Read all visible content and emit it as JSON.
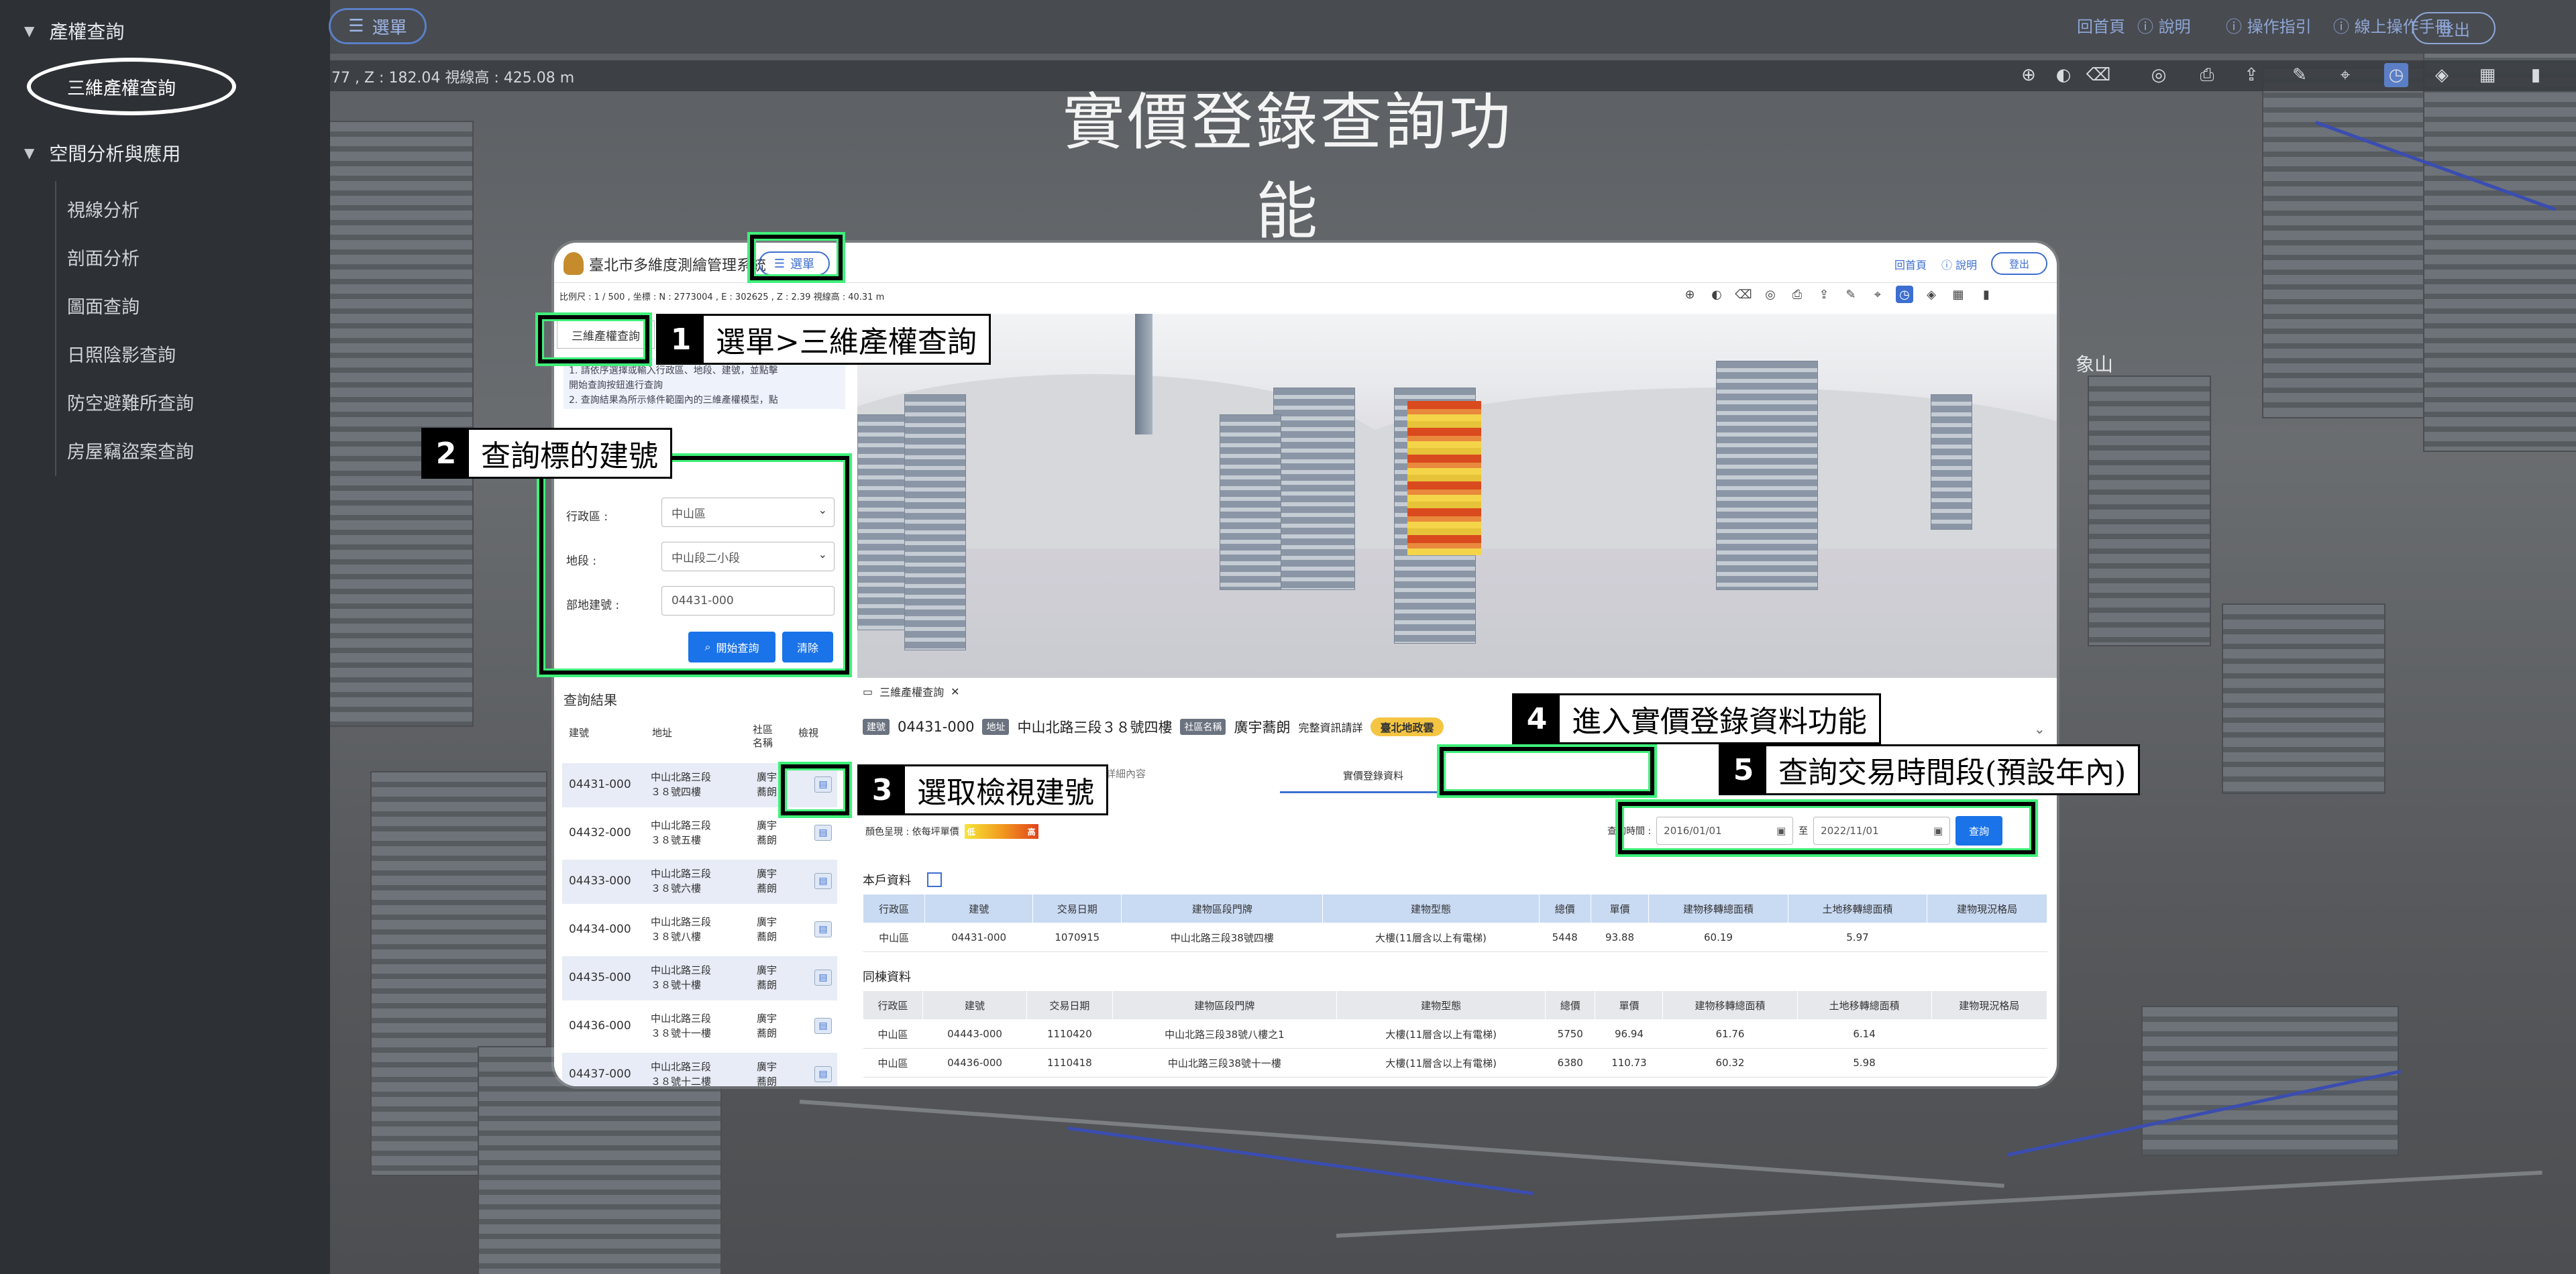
{
  "sidebar": {
    "groups": [
      {
        "label": "產權查詢",
        "items": [
          "三維產權查詢"
        ]
      },
      {
        "label": "空間分析與應用",
        "items": [
          "視線分析",
          "剖面分析",
          "圖面查詢",
          "日照陰影查詢",
          "防空避難所查詢",
          "房屋竊盜案查詢"
        ]
      }
    ],
    "active_item": "三維產權查詢"
  },
  "topbar": {
    "menu_label": "選單",
    "links": [
      "回首頁",
      "說明",
      "操作指引",
      "線上操作手冊"
    ],
    "logout_label": "登出"
  },
  "coords_text": "77 , Z : 182.04 視線高 : 425.08 m",
  "map_landmark": "象山",
  "main_title": "實價登錄查詢功能",
  "panel": {
    "app_title": "臺北市多維度測繪管理系統",
    "menu_label": "選單",
    "links": [
      "回首頁",
      "說明"
    ],
    "logout_label": "登出",
    "coords_text": "比例尺 : 1 / 500 , 坐標 : N : 2773004 , E : 302625 , Z : 2.39 視線高 : 40.31 m",
    "query_tab": "三維產權查詢",
    "notes": [
      "1. 請依序選擇或輸入行政區、地段、建號，並點擊",
      "開始查詢按鈕進行查詢",
      "2. 查詢結果為所示條件範圍內的三維產權模型，點"
    ],
    "form": {
      "district_label": "行政區 :",
      "district_value": "中山區",
      "section_label": "地段 :",
      "section_value": "中山段二小段",
      "building_label": "部地建號 :",
      "building_value": "04431-000",
      "search_btn": "開始查詢",
      "clear_btn": "清除"
    },
    "results": {
      "title": "查詢結果",
      "headers": [
        "建號",
        "地址",
        "社區名稱",
        "檢視"
      ],
      "rows": [
        {
          "no": "04431-000",
          "addr": "中山北路三段３８號四樓",
          "name": "廣宇蕎朗"
        },
        {
          "no": "04432-000",
          "addr": "中山北路三段３８號五樓",
          "name": "廣宇蕎朗"
        },
        {
          "no": "04433-000",
          "addr": "中山北路三段３８號六樓",
          "name": "廣宇蕎朗"
        },
        {
          "no": "04434-000",
          "addr": "中山北路三段３８號八樓",
          "name": "廣宇蕎朗"
        },
        {
          "no": "04435-000",
          "addr": "中山北路三段３８號十樓",
          "name": "廣宇蕎朗"
        },
        {
          "no": "04436-000",
          "addr": "中山北路三段３８號十一樓",
          "name": "廣宇蕎朗"
        },
        {
          "no": "04437-000",
          "addr": "中山北路三段３８號十二樓",
          "name": "廣宇蕎朗"
        }
      ]
    },
    "data": {
      "tab_label": "三維產權查詢",
      "tag_no": "建號",
      "building_no": "04431-000",
      "tag_addr": "地址",
      "address": "中山北路三段３８號四樓",
      "tag_comm": "社區名稱",
      "community": "廣宇蕎朗",
      "detail_link": "完整資訊請詳",
      "badge": "臺北地政雲",
      "sub_tab1": "詳細內容",
      "sub_tab2": "實價登錄資料",
      "legend_label": "顏色呈現 : 依每坪單價",
      "legend_low": "低",
      "legend_high": "高",
      "date_label": "查詢時間 :",
      "date_from": "2016/01/01",
      "date_to": "2022/11/01",
      "date_sep": "至",
      "date_btn": "查詢",
      "own_title": "本戶資料",
      "same_title": "同棟資料",
      "table_headers": [
        "行政區",
        "建號",
        "交易日期",
        "建物區段門牌",
        "建物型態",
        "總價",
        "單價",
        "建物移轉總面積",
        "土地移轉總面積",
        "建物現況格局"
      ],
      "own_rows": [
        [
          "中山區",
          "04431-000",
          "1070915",
          "中山北路三段38號四樓",
          "大樓(11層含以上有電梯)",
          "5448",
          "93.88",
          "60.19",
          "5.97",
          ""
        ]
      ],
      "same_rows": [
        [
          "中山區",
          "04443-000",
          "1110420",
          "中山北路三段38號八樓之1",
          "大樓(11層含以上有電梯)",
          "5750",
          "96.94",
          "61.76",
          "6.14",
          ""
        ],
        [
          "中山區",
          "04436-000",
          "1110418",
          "中山北路三段38號十一樓",
          "大樓(11層含以上有電梯)",
          "6380",
          "110.73",
          "60.32",
          "5.98",
          ""
        ]
      ]
    }
  },
  "callouts": [
    {
      "num": "1",
      "text": "選單>三維產權查詢"
    },
    {
      "num": "2",
      "text": "查詢標的建號"
    },
    {
      "num": "3",
      "text": "選取檢視建號"
    },
    {
      "num": "4",
      "text": "進入實價登錄資料功能"
    },
    {
      "num": "5",
      "text": "查詢交易時間段(預設年內)"
    }
  ],
  "colors": {
    "sidebar_bg": "#2d3136",
    "accent": "#1a73e8",
    "highlight": "#3ff07a"
  },
  "icons": [
    "compass-icon",
    "globe-icon",
    "eraser-icon",
    "world-icon",
    "print-icon",
    "share-icon",
    "ruler-icon",
    "pin-icon",
    "clock-icon",
    "layers-icon",
    "grid-icon",
    "bookmark-icon"
  ]
}
